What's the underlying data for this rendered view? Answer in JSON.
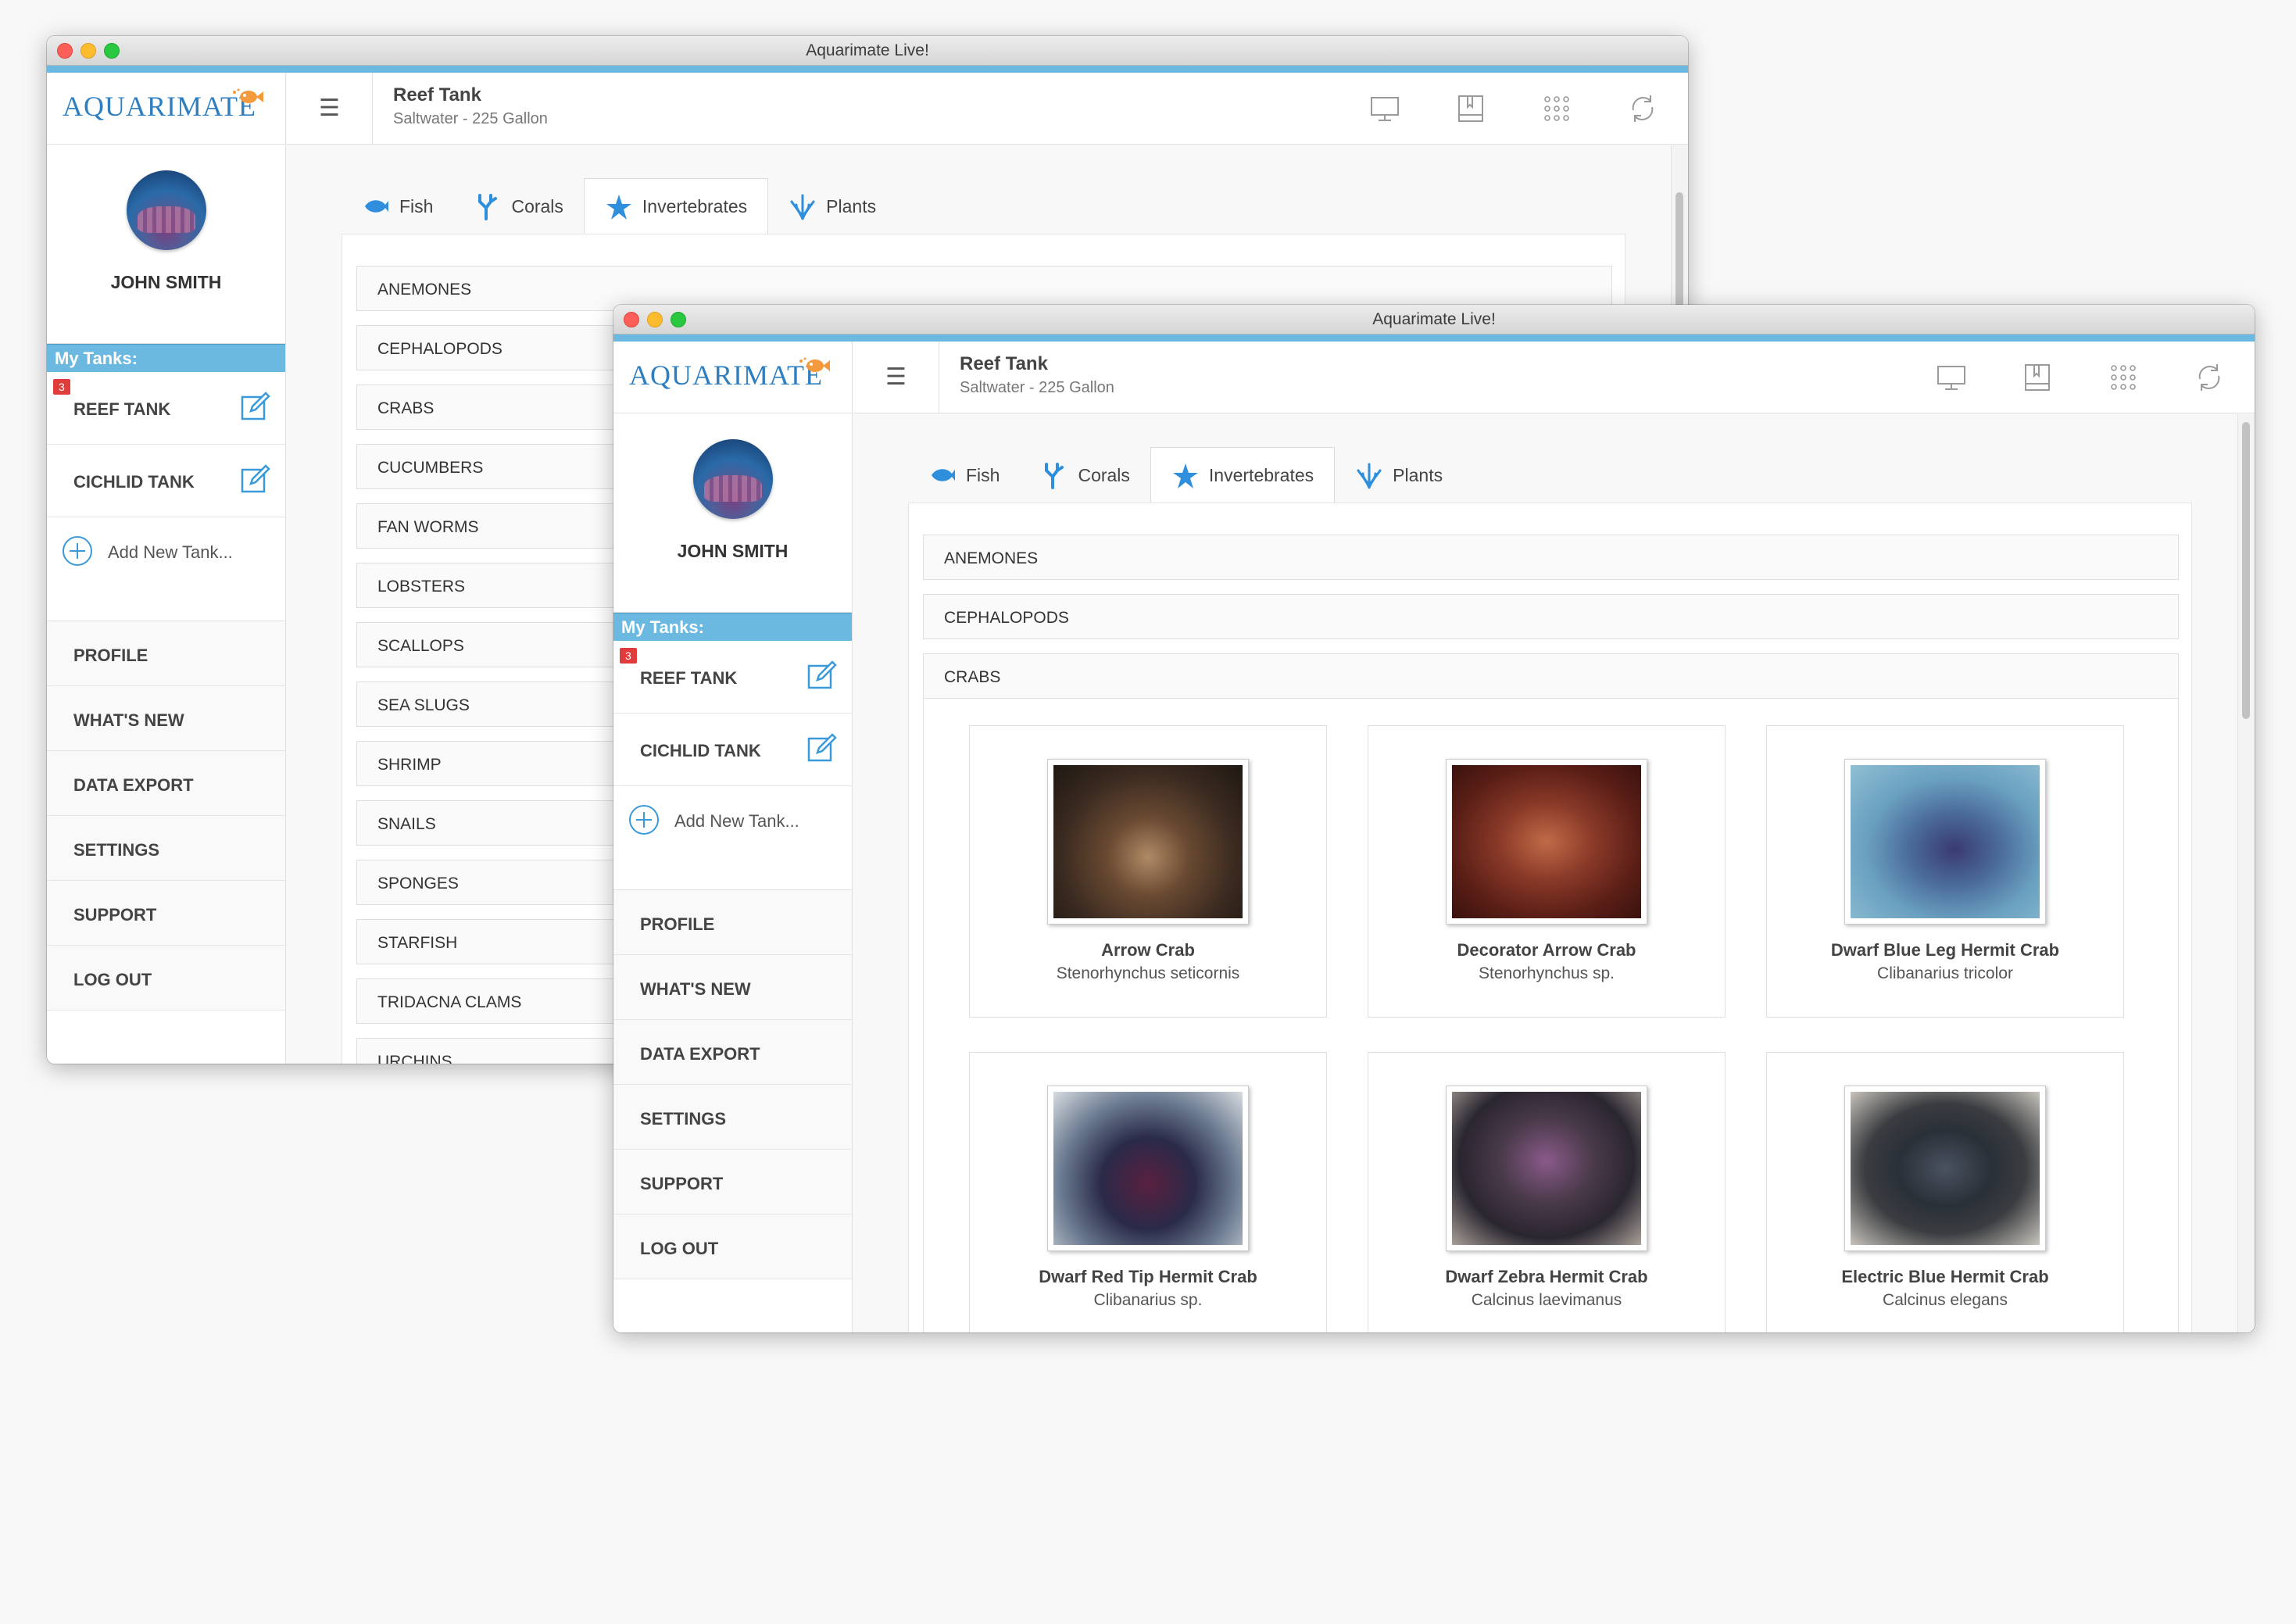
{
  "window": {
    "title": "Aquarimate Live!"
  },
  "brand": {
    "logo_text": "AQUARIMATE"
  },
  "user": {
    "name": "JOHN SMITH"
  },
  "sidebar": {
    "tanks_header": "My Tanks:",
    "tanks": [
      {
        "name": "REEF TANK",
        "badge": "3"
      },
      {
        "name": "CICHLID TANK"
      }
    ],
    "add_tank_label": "Add New Tank...",
    "menu": [
      "PROFILE",
      "WHAT'S NEW",
      "DATA EXPORT",
      "SETTINGS",
      "SUPPORT",
      "LOG OUT"
    ]
  },
  "topbar": {
    "tank_name": "Reef Tank",
    "tank_info": "Saltwater - 225 Gallon",
    "icons": [
      "monitor-icon",
      "book-icon",
      "grid-icon",
      "sync-icon"
    ]
  },
  "tabs": [
    {
      "label": "Fish",
      "icon": "fish-icon"
    },
    {
      "label": "Corals",
      "icon": "coral-icon"
    },
    {
      "label": "Invertebrates",
      "icon": "starfish-icon",
      "active": true
    },
    {
      "label": "Plants",
      "icon": "plant-icon"
    }
  ],
  "categories": [
    "ANEMONES",
    "CEPHALOPODS",
    "CRABS",
    "CUCUMBERS",
    "FAN WORMS",
    "LOBSTERS",
    "SCALLOPS",
    "SEA SLUGS",
    "SHRIMP",
    "SNAILS",
    "SPONGES",
    "STARFISH",
    "TRIDACNA CLAMS",
    "URCHINS"
  ],
  "crabs": [
    {
      "name": "Arrow Crab",
      "scientific": "Stenorhynchus seticornis"
    },
    {
      "name": "Decorator Arrow Crab",
      "scientific": "Stenorhynchus sp."
    },
    {
      "name": "Dwarf Blue Leg Hermit Crab",
      "scientific": "Clibanarius tricolor"
    },
    {
      "name": "Dwarf Red Tip Hermit Crab",
      "scientific": "Clibanarius sp."
    },
    {
      "name": "Dwarf Zebra Hermit Crab",
      "scientific": "Calcinus laevimanus"
    },
    {
      "name": "Electric Blue Hermit Crab",
      "scientific": "Calcinus elegans"
    }
  ],
  "colors": {
    "accent": "#6bb8e0",
    "badge": "#e03c3c",
    "logo": "#2f7fc0"
  }
}
